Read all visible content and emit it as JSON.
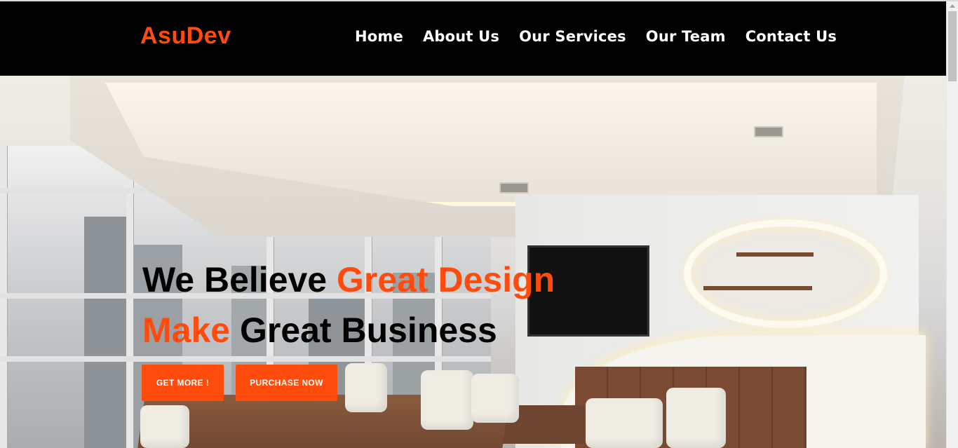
{
  "brand": "AsuDev",
  "nav": {
    "items": [
      "Home",
      "About Us",
      "Our Services",
      "Our Team",
      "Contact Us"
    ]
  },
  "hero": {
    "line1_a": "We Believe ",
    "line1_b": "Great Design",
    "line2_a": "Make",
    "line2_b": " Great Business",
    "button_primary": "GET MORE !",
    "button_secondary": "PURCHASE NOW",
    "background": "office-interior-photo"
  },
  "colors": {
    "accent": "#ff4c0c",
    "navbar": "#000000",
    "nav_text": "#ffffff"
  }
}
